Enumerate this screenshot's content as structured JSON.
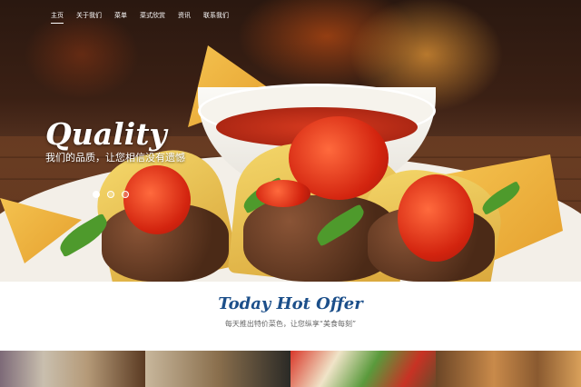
{
  "nav": {
    "items": [
      {
        "label": "主页"
      },
      {
        "label": "关于我们"
      },
      {
        "label": "菜单"
      },
      {
        "label": "菜式欣赏"
      },
      {
        "label": "资讯"
      },
      {
        "label": "联系我们"
      }
    ],
    "active_index": 0
  },
  "hero": {
    "title": "Quality",
    "subtitle": "我们的品质，让您相信没有遗憾",
    "slides": 3,
    "active_slide": 0
  },
  "offer": {
    "title": "Today Hot Offer",
    "subtitle": "每天推出特价菜色，让您纵享“美食每刻”"
  },
  "gallery": {
    "tiles": [
      "food-photo-1",
      "food-photo-2",
      "food-photo-3",
      "food-photo-4"
    ]
  },
  "colors": {
    "offer_title": "#1c4f8a",
    "nav_text": "#ffffff"
  }
}
